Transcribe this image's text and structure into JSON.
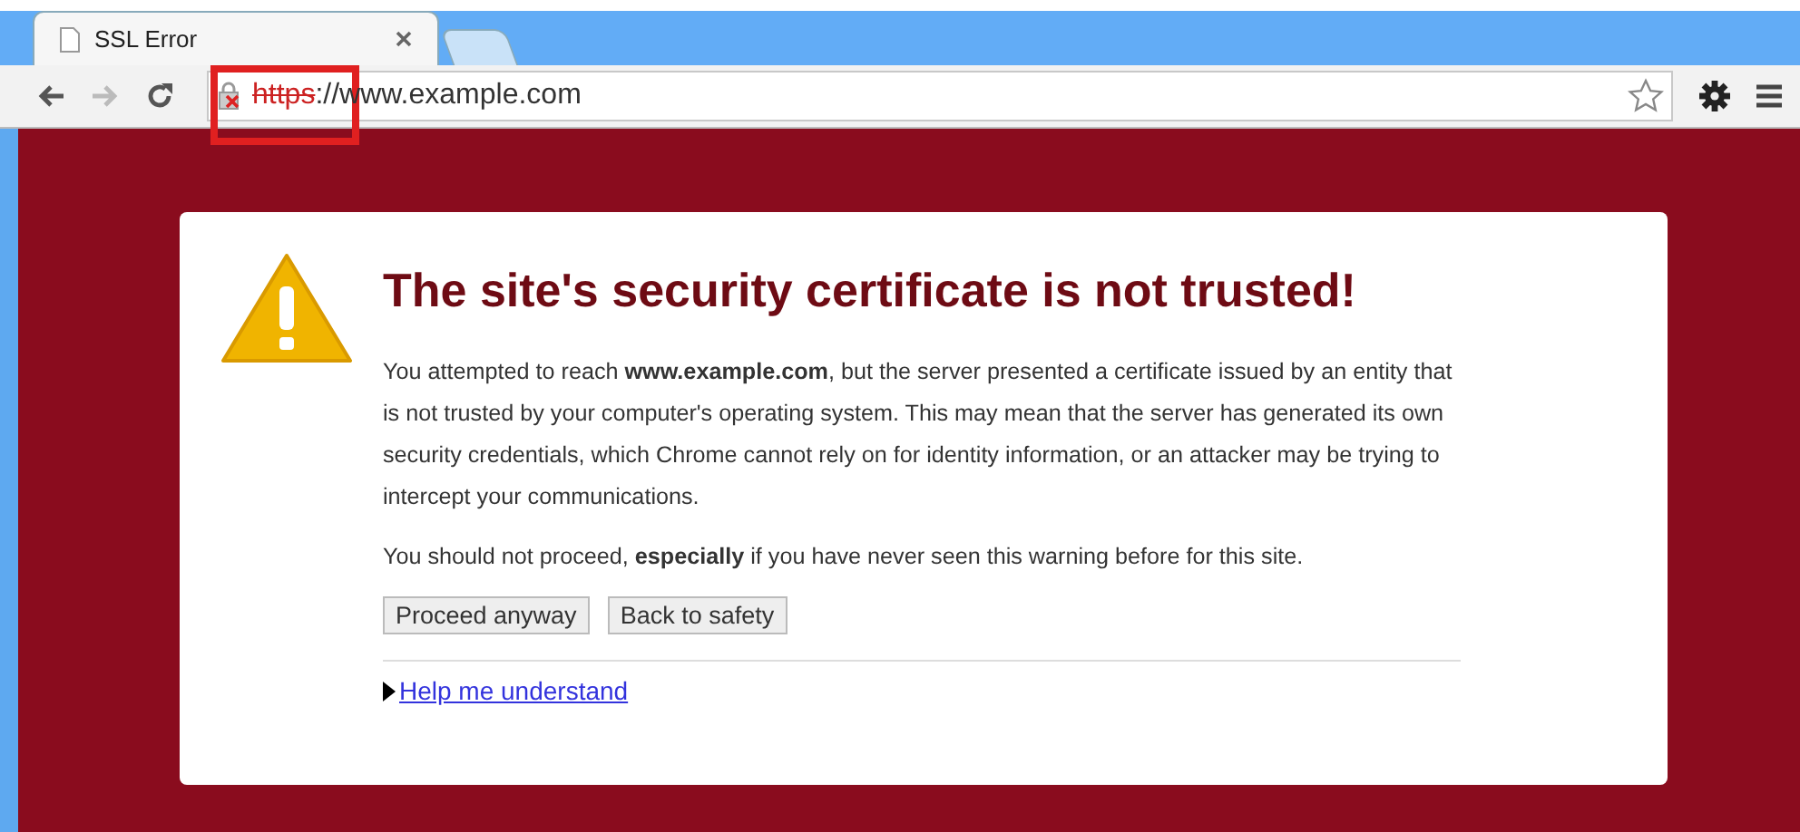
{
  "tabs": [
    {
      "title": "SSL Error",
      "selected": true
    },
    {
      "selected": false
    }
  ],
  "address_bar": {
    "scheme": "https",
    "rest": "://www.example.com",
    "insecure": true,
    "highlighted": true
  },
  "error_page": {
    "heading": "The site's security certificate is not trusted!",
    "paragraphs": [
      "You attempted to reach **www.example.com**, but the server presented a certificate issued by an entity that is not trusted by your computer's operating system. This may mean that the server has generated its own security credentials, which Chrome cannot rely on for identity information, or an attacker may be trying to intercept your communications.",
      "You should not proceed, **especially** if you have never seen this warning before for this site."
    ],
    "buttons": [
      "Proceed anyway",
      "Back to safety"
    ],
    "help_link": {
      "label": "Help me understand",
      "expanded": false
    }
  }
}
